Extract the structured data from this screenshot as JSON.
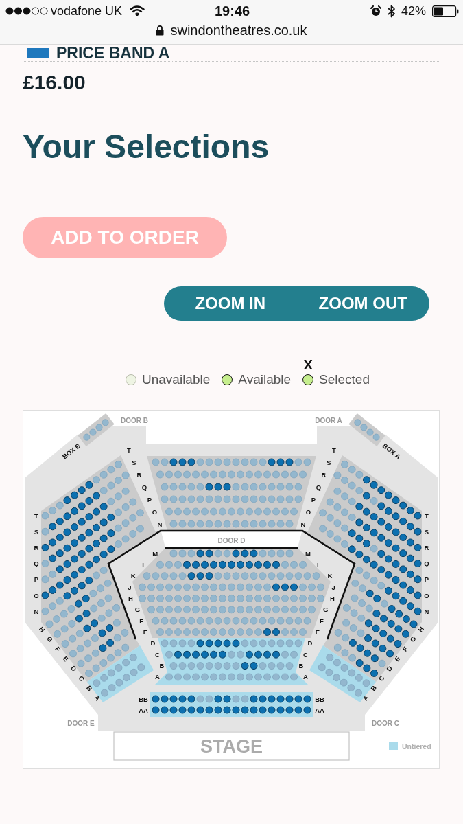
{
  "status_bar": {
    "carrier": "vodafone UK",
    "time": "19:46",
    "battery": "42%"
  },
  "address_bar": {
    "url": "swindontheatres.co.uk"
  },
  "price_band": {
    "name": "PRICE BAND A",
    "price": "£16.00"
  },
  "selections": {
    "title": "Your Selections",
    "add_button": "ADD TO ORDER"
  },
  "zoom_controls": [
    "ZOOM IN",
    "ZOOM OUT"
  ],
  "legend": [
    {
      "kind": "unavailable",
      "label": "Unavailable"
    },
    {
      "kind": "available",
      "label": "Available"
    },
    {
      "kind": "selected",
      "label": "Selected",
      "mark": "X"
    }
  ],
  "seat_map": {
    "doors": [
      "DOOR B",
      "DOOR A",
      "DOOR D",
      "DOOR E",
      "DOOR C"
    ],
    "boxes": [
      {
        "label": "BOX B",
        "available": [
          false,
          false,
          false,
          false
        ]
      },
      {
        "label": "BOX A",
        "available": [
          false,
          false,
          false,
          false
        ]
      }
    ],
    "sections": [
      {
        "kind": "wing-left",
        "rows": [
          {
            "label": "T",
            "available": [
              false,
              false,
              false,
              true,
              true,
              true,
              true,
              false,
              false,
              false,
              false
            ]
          },
          {
            "label": "S",
            "available": [
              false,
              true,
              true,
              true,
              true,
              true,
              true,
              true,
              false,
              false,
              false,
              false
            ]
          },
          {
            "label": "R",
            "available": [
              true,
              true,
              true,
              true,
              true,
              true,
              true,
              true,
              true,
              false,
              false,
              false
            ]
          },
          {
            "label": "Q",
            "available": [
              false,
              true,
              true,
              true,
              true,
              true,
              true,
              true,
              true,
              true,
              false,
              false,
              false
            ]
          },
          {
            "label": "P",
            "available": [
              false,
              false,
              true,
              true,
              true,
              true,
              true,
              true,
              true,
              true,
              false,
              false,
              false,
              false
            ]
          },
          {
            "label": "O",
            "available": [
              true,
              true,
              true,
              true,
              true,
              true,
              true,
              true,
              true,
              true,
              false,
              false,
              false,
              false
            ]
          },
          {
            "label": "N",
            "available": [
              false,
              false,
              false,
              true,
              true,
              true,
              true,
              false,
              false
            ]
          },
          {
            "label": "H",
            "available": [
              false,
              false,
              false,
              false,
              true,
              true,
              false,
              false,
              false
            ]
          },
          {
            "label": "G",
            "available": [
              false,
              false,
              false,
              true,
              true,
              false,
              false,
              false
            ]
          },
          {
            "label": "F",
            "available": [
              false,
              false,
              false,
              true,
              true,
              false,
              false,
              false
            ]
          },
          {
            "label": "E",
            "available": [
              false,
              false,
              false,
              false,
              true,
              true,
              false
            ]
          },
          {
            "label": "D",
            "available": [
              false,
              false,
              false,
              true,
              true,
              false,
              false
            ]
          },
          {
            "label": "C",
            "available": [
              false,
              false,
              false,
              false,
              false,
              false
            ]
          },
          {
            "label": "B",
            "available": [
              false,
              false,
              false,
              false,
              false,
              false
            ]
          },
          {
            "label": "A",
            "available": [
              false,
              false,
              false,
              false,
              false,
              false
            ]
          }
        ]
      },
      {
        "kind": "centre-upper",
        "rows": [
          {
            "label_left": "T",
            "label_right": "T"
          },
          {
            "label_left": "S",
            "label_right": "S",
            "available": [
              false,
              false,
              true,
              true,
              true,
              false,
              false,
              false,
              false,
              false,
              false,
              false,
              false,
              true,
              true,
              true,
              false,
              false
            ]
          },
          {
            "label_left": "R",
            "label_right": "R",
            "available": [
              false,
              false,
              false,
              false,
              false,
              false,
              false,
              false,
              false,
              false,
              false,
              false,
              false,
              false,
              false,
              false,
              false
            ]
          },
          {
            "label_left": "Q",
            "label_right": "Q",
            "available": [
              false,
              false,
              false,
              false,
              false,
              true,
              true,
              true,
              false,
              false,
              false,
              false,
              false,
              false,
              false,
              false
            ]
          },
          {
            "label_left": "P",
            "label_right": "P",
            "available": [
              false,
              false,
              false,
              false,
              false,
              false,
              false,
              false,
              false,
              false,
              false,
              false,
              false,
              false,
              false,
              false
            ]
          },
          {
            "label_left": "O",
            "label_right": "O",
            "available": [
              false,
              false,
              false,
              false,
              false,
              false,
              false,
              false,
              false,
              false,
              false,
              false,
              false,
              false,
              false
            ]
          },
          {
            "label_left": "N",
            "label_right": "N",
            "available": [
              false,
              false,
              false,
              false,
              false,
              false,
              false,
              false,
              false,
              false,
              false,
              false,
              false,
              false
            ]
          }
        ]
      },
      {
        "kind": "wing-right",
        "rows": [
          {
            "label": "T",
            "available": [
              true,
              true,
              true,
              true,
              true,
              true,
              true,
              true,
              false,
              false,
              false
            ]
          },
          {
            "label": "S",
            "available": [
              true,
              true,
              true,
              true,
              true,
              true,
              false,
              true,
              false,
              false,
              false,
              false
            ]
          },
          {
            "label": "R",
            "available": [
              true,
              true,
              true,
              true,
              true,
              true,
              true,
              true,
              true,
              false,
              false,
              false
            ]
          },
          {
            "label": "Q",
            "available": [
              true,
              true,
              true,
              true,
              true,
              true,
              true,
              true,
              true,
              false,
              false,
              false,
              false
            ]
          },
          {
            "label": "P",
            "available": [
              true,
              true,
              true,
              true,
              true,
              true,
              false,
              true,
              true,
              true,
              false,
              false,
              false,
              false
            ]
          },
          {
            "label": "O",
            "available": [
              true,
              true,
              true,
              true,
              true,
              true,
              true,
              true,
              true,
              true,
              false,
              false,
              false,
              false
            ]
          },
          {
            "label": "N",
            "available": [
              true,
              true,
              true,
              true,
              true,
              false,
              false,
              false,
              false
            ]
          },
          {
            "label": "H",
            "available": [
              true,
              true,
              true,
              true,
              false,
              true,
              true,
              false,
              false
            ]
          },
          {
            "label": "G",
            "available": [
              true,
              true,
              true,
              true,
              true,
              false,
              false,
              false
            ]
          },
          {
            "label": "F",
            "available": [
              true,
              true,
              true,
              true,
              true,
              false,
              false,
              false
            ]
          },
          {
            "label": "E",
            "available": [
              true,
              true,
              true,
              true,
              false,
              false,
              false
            ]
          },
          {
            "label": "D",
            "available": [
              false,
              true,
              true,
              true,
              true,
              false,
              false
            ]
          },
          {
            "label": "C",
            "available": [
              true,
              true,
              true,
              false,
              false,
              false
            ]
          },
          {
            "label": "B",
            "available": [
              false,
              false,
              false,
              false,
              false,
              false
            ]
          },
          {
            "label": "A",
            "available": [
              false,
              false,
              false,
              false,
              false,
              false
            ]
          }
        ]
      },
      {
        "kind": "centre-lower",
        "rows": [
          {
            "label_left": "M",
            "label_right": "M",
            "available": [
              false,
              false,
              false,
              true,
              true,
              false,
              false,
              true,
              true,
              true,
              false,
              false,
              false,
              false
            ]
          },
          {
            "label_left": "L",
            "label_right": "L",
            "available": [
              false,
              false,
              false,
              true,
              true,
              true,
              true,
              true,
              true,
              true,
              true,
              true,
              true,
              true,
              false,
              false,
              false
            ]
          },
          {
            "label_left": "K",
            "label_right": "K",
            "available": [
              false,
              false,
              false,
              false,
              false,
              true,
              true,
              true,
              false,
              false,
              false,
              false,
              false,
              false,
              false,
              false,
              false,
              false,
              false,
              false
            ]
          },
          {
            "label_left": "J",
            "label_right": "J",
            "available": [
              false,
              false,
              false,
              false,
              false,
              false,
              false,
              false,
              false,
              false,
              false,
              false,
              false,
              false,
              false,
              true,
              true,
              true,
              false,
              false,
              false
            ]
          },
          {
            "label_left": "H",
            "label_right": "H",
            "available": [
              false,
              false,
              false,
              false,
              false,
              false,
              false,
              false,
              false,
              false,
              false,
              false,
              false,
              false,
              false,
              false,
              false,
              false,
              false,
              false,
              false
            ]
          },
          {
            "label_left": "G",
            "label_right": "G",
            "available": [
              false,
              false,
              false,
              false,
              false,
              false,
              false,
              false,
              false,
              false,
              false,
              false,
              false,
              false,
              false,
              false,
              false,
              false,
              false
            ]
          },
          {
            "label_left": "F",
            "label_right": "F",
            "available": [
              false,
              false,
              false,
              false,
              false,
              false,
              false,
              false,
              false,
              false,
              false,
              false,
              false,
              false,
              false,
              false,
              false,
              false
            ]
          },
          {
            "label_left": "E",
            "label_right": "E",
            "available": [
              false,
              false,
              false,
              false,
              false,
              false,
              false,
              false,
              false,
              false,
              false,
              false,
              true,
              true,
              false,
              false,
              false
            ]
          },
          {
            "label_left": "D",
            "label_right": "D",
            "available": [
              false,
              false,
              false,
              false,
              true,
              true,
              true,
              true,
              true,
              false,
              false,
              false,
              false,
              false,
              false,
              false
            ]
          },
          {
            "label_left": "C",
            "label_right": "C",
            "available": [
              false,
              true,
              true,
              true,
              true,
              true,
              true,
              false,
              false,
              true,
              true,
              true,
              true,
              false,
              false
            ]
          },
          {
            "label_left": "B",
            "label_right": "B",
            "available": [
              false,
              false,
              false,
              false,
              false,
              false,
              false,
              false,
              true,
              true,
              false,
              false,
              false,
              false
            ]
          },
          {
            "label_left": "A",
            "label_right": "A",
            "available": [
              false,
              false,
              false,
              false,
              false,
              false,
              false,
              false,
              false,
              false,
              false,
              false,
              false,
              false,
              false
            ]
          }
        ]
      },
      {
        "kind": "front",
        "rows": [
          {
            "label_left": "BB",
            "label_right": "BB",
            "available": [
              true,
              true,
              true,
              true,
              true,
              false,
              false,
              true,
              true,
              false,
              false,
              true,
              true,
              true,
              true,
              true,
              true,
              true
            ]
          },
          {
            "label_left": "AA",
            "label_right": "AA",
            "available": [
              true,
              true,
              true,
              true,
              true,
              true,
              true,
              true,
              true,
              true,
              true,
              true,
              true,
              true,
              true,
              true,
              true,
              true
            ]
          }
        ]
      }
    ],
    "stage": "STAGE",
    "untiered_key": "Untiered"
  }
}
